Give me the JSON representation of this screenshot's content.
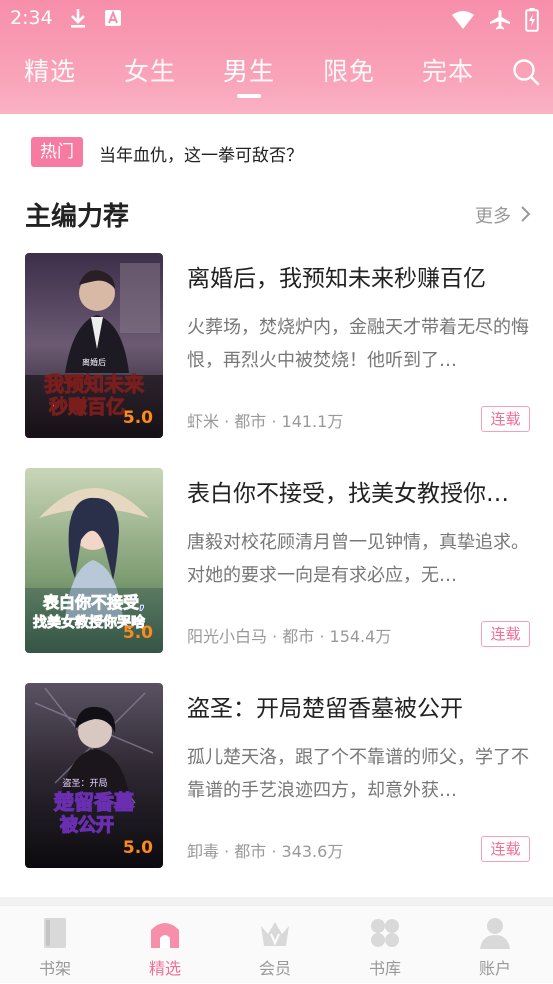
{
  "status_bar": {
    "time": "2:34"
  },
  "tabs": [
    {
      "label": "精选"
    },
    {
      "label": "女生"
    },
    {
      "label": "男生",
      "active": true
    },
    {
      "label": "限免"
    },
    {
      "label": "完本"
    }
  ],
  "hot": {
    "badge": "热门",
    "text": "当年血仇，这一拳可敌否？"
  },
  "section": {
    "title": "主编力荐",
    "more": "更多"
  },
  "books": [
    {
      "title": "离婚后，我预知未来秒赚百亿",
      "desc": "火葬场，焚烧炉内，金融天才带着无尽的悔恨，再烈火中被焚烧！他听到了…",
      "meta": "虾米 · 都市 · 141.1万",
      "status": "连载",
      "rating": "5.0",
      "cover_text": "我预知未来秒赚百亿",
      "cover_small": "离婚后"
    },
    {
      "title": "表白你不接受，找美女教授你…",
      "desc": "唐毅对校花顾清月曾一见钟情，真挚追求。对她的要求一向是有求必应，无…",
      "meta": "阳光小白马 · 都市 · 154.4万",
      "status": "连载",
      "rating": "5.0",
      "cover_text": "表白你不接受，找美女教授你哭啥？"
    },
    {
      "title": "盗圣：开局楚留香墓被公开",
      "desc": "孤儿楚天洛，跟了个不靠谱的师父，学了不靠谱的手艺浪迹四方，却意外获…",
      "meta": "卸毒 · 都市 · 343.6万",
      "status": "连载",
      "rating": "5.0",
      "cover_text": "楚留香墓被公开",
      "cover_small": "盗圣：开局"
    }
  ],
  "bottom_nav": [
    {
      "label": "书架",
      "icon": "bookshelf-icon"
    },
    {
      "label": "精选",
      "icon": "home-icon",
      "active": true
    },
    {
      "label": "会员",
      "icon": "crown-icon"
    },
    {
      "label": "书库",
      "icon": "library-grid-icon"
    },
    {
      "label": "账户",
      "icon": "account-icon"
    }
  ],
  "colors": {
    "accent": "#f26f98",
    "header": "#f78eaa",
    "rating": "#ff8a1a"
  }
}
